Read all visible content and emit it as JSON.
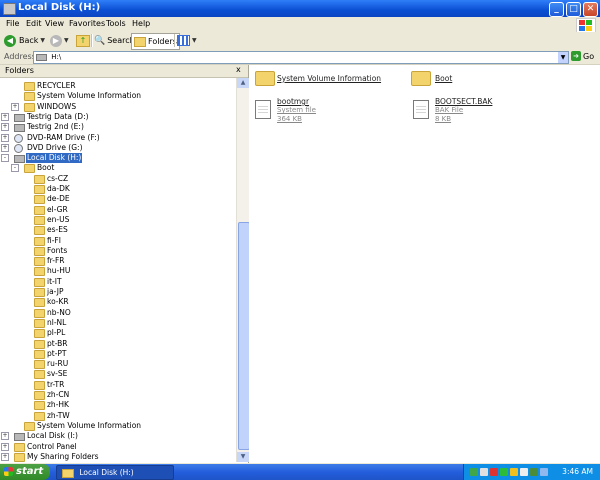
{
  "window": {
    "title": "Local Disk (H:)",
    "buttons": {
      "minimize": "_",
      "maximize": "□",
      "close": "✕"
    }
  },
  "menubar": {
    "items": [
      "File",
      "Edit",
      "View",
      "Favorites",
      "Tools",
      "Help"
    ]
  },
  "toolbar": {
    "back": "Back",
    "search": "Search",
    "folders": "Folders"
  },
  "address": {
    "label": "Address",
    "value": "H:\\",
    "go": "Go"
  },
  "folders_pane": {
    "title": "Folders",
    "close": "x",
    "tree": [
      {
        "label": "RECYCLER",
        "indent": 2,
        "expander": "",
        "icon": "folder-icon"
      },
      {
        "label": "System Volume Information",
        "indent": 2,
        "expander": "",
        "icon": "folder-icon"
      },
      {
        "label": "WINDOWS",
        "indent": 2,
        "expander": "+",
        "icon": "folder-icon"
      },
      {
        "label": "Testrig Data (D:)",
        "indent": 1,
        "expander": "+",
        "icon": "drive-icon"
      },
      {
        "label": "Testrig 2nd (E:)",
        "indent": 1,
        "expander": "+",
        "icon": "drive-icon"
      },
      {
        "label": "DVD-RAM Drive (F:)",
        "indent": 1,
        "expander": "+",
        "icon": "dvd-icon"
      },
      {
        "label": "DVD Drive (G:)",
        "indent": 1,
        "expander": "+",
        "icon": "dvd-icon"
      },
      {
        "label": "Local Disk (H:)",
        "indent": 1,
        "expander": "-",
        "icon": "drive-icon",
        "selected": true
      },
      {
        "label": "Boot",
        "indent": 2,
        "expander": "-",
        "icon": "folder-icon"
      },
      {
        "label": "cs-CZ",
        "indent": 3,
        "expander": "",
        "icon": "folder-icon"
      },
      {
        "label": "da-DK",
        "indent": 3,
        "expander": "",
        "icon": "folder-icon"
      },
      {
        "label": "de-DE",
        "indent": 3,
        "expander": "",
        "icon": "folder-icon"
      },
      {
        "label": "el-GR",
        "indent": 3,
        "expander": "",
        "icon": "folder-icon"
      },
      {
        "label": "en-US",
        "indent": 3,
        "expander": "",
        "icon": "folder-icon"
      },
      {
        "label": "es-ES",
        "indent": 3,
        "expander": "",
        "icon": "folder-icon"
      },
      {
        "label": "fi-FI",
        "indent": 3,
        "expander": "",
        "icon": "folder-icon"
      },
      {
        "label": "Fonts",
        "indent": 3,
        "expander": "",
        "icon": "folder-icon"
      },
      {
        "label": "fr-FR",
        "indent": 3,
        "expander": "",
        "icon": "folder-icon"
      },
      {
        "label": "hu-HU",
        "indent": 3,
        "expander": "",
        "icon": "folder-icon"
      },
      {
        "label": "it-IT",
        "indent": 3,
        "expander": "",
        "icon": "folder-icon"
      },
      {
        "label": "ja-JP",
        "indent": 3,
        "expander": "",
        "icon": "folder-icon"
      },
      {
        "label": "ko-KR",
        "indent": 3,
        "expander": "",
        "icon": "folder-icon"
      },
      {
        "label": "nb-NO",
        "indent": 3,
        "expander": "",
        "icon": "folder-icon"
      },
      {
        "label": "nl-NL",
        "indent": 3,
        "expander": "",
        "icon": "folder-icon"
      },
      {
        "label": "pl-PL",
        "indent": 3,
        "expander": "",
        "icon": "folder-icon"
      },
      {
        "label": "pt-BR",
        "indent": 3,
        "expander": "",
        "icon": "folder-icon"
      },
      {
        "label": "pt-PT",
        "indent": 3,
        "expander": "",
        "icon": "folder-icon"
      },
      {
        "label": "ru-RU",
        "indent": 3,
        "expander": "",
        "icon": "folder-icon"
      },
      {
        "label": "sv-SE",
        "indent": 3,
        "expander": "",
        "icon": "folder-icon"
      },
      {
        "label": "tr-TR",
        "indent": 3,
        "expander": "",
        "icon": "folder-icon"
      },
      {
        "label": "zh-CN",
        "indent": 3,
        "expander": "",
        "icon": "folder-icon"
      },
      {
        "label": "zh-HK",
        "indent": 3,
        "expander": "",
        "icon": "folder-icon"
      },
      {
        "label": "zh-TW",
        "indent": 3,
        "expander": "",
        "icon": "folder-icon"
      },
      {
        "label": "System Volume Information",
        "indent": 2,
        "expander": "",
        "icon": "folder-icon"
      },
      {
        "label": "Local Disk (I:)",
        "indent": 1,
        "expander": "+",
        "icon": "drive-icon"
      },
      {
        "label": "Control Panel",
        "indent": 1,
        "expander": "+",
        "icon": "folder-icon"
      },
      {
        "label": "My Sharing Folders",
        "indent": 1,
        "expander": "+",
        "icon": "folder-icon"
      }
    ]
  },
  "content": {
    "items": [
      {
        "name": "System Volume Information",
        "type": "folder",
        "subtitle": "",
        "size": "",
        "icon": "folder-icon"
      },
      {
        "name": "Boot",
        "type": "folder",
        "subtitle": "",
        "size": "",
        "icon": "folder-icon"
      },
      {
        "name": "bootmgr",
        "type": "file",
        "subtitle": "System file",
        "size": "364 KB",
        "icon": "system-file-icon"
      },
      {
        "name": "BOOTSECT.BAK",
        "type": "file",
        "subtitle": "BAK File",
        "size": "8 KB",
        "icon": "bak-file-icon"
      }
    ]
  },
  "taskbar": {
    "start": "start",
    "task": "Local Disk (H:)",
    "clock": "3:46 AM"
  },
  "colors": {
    "titlebar": "#0a4fd3",
    "selection": "#316ac5",
    "taskbar": "#245edc",
    "start": "#2f8a27",
    "tray": "#0f8ee6"
  }
}
